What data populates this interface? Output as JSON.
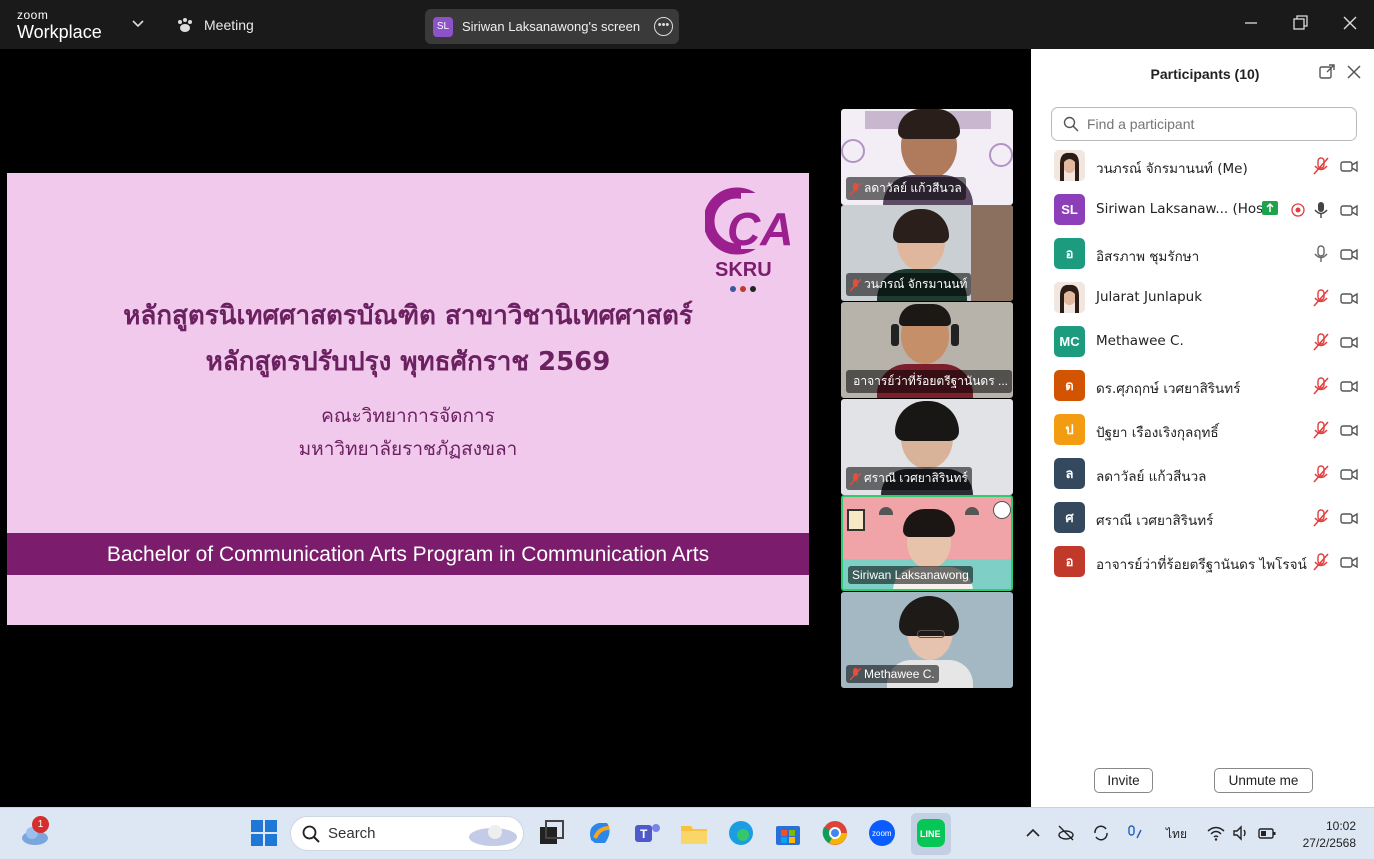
{
  "app": {
    "brand_top": "zoom",
    "brand_bottom": "Workplace",
    "meeting_label": "Meeting"
  },
  "share": {
    "avatar": "SL",
    "label": "Siriwan Laksanawong's screen"
  },
  "slide": {
    "line1": "หลักสูตรนิเทศศาสตรบัณฑิต สาขาวิชานิเทศศาสตร์",
    "line2": "หลักสูตรปรับปรุง พุทธศักราช 2569",
    "line3": "คณะวิทยาการจัดการ",
    "line4": "มหาวิทยาลัยราชภัฏสงขลา",
    "band": "Bachelor of Communication Arts Program in Communication Arts",
    "logo_text": "CA",
    "logo_sub": "SKRU"
  },
  "video_tiles": [
    {
      "name": "ลดาวัลย์ แก้วสีนวล",
      "muted": true
    },
    {
      "name": "วนภรณ์ จักรมานนท์",
      "muted": true
    },
    {
      "name": "อาจารย์ว่าที่ร้อยตรีฐานันดร ...",
      "muted": true
    },
    {
      "name": "ศราณี เวศยาสิรินทร์",
      "muted": true
    },
    {
      "name": "Siriwan Laksanawong",
      "muted": false
    },
    {
      "name": "Methawee C.",
      "muted": true
    }
  ],
  "participants": {
    "title": "Participants (10)",
    "search_placeholder": "Find a participant",
    "list": [
      {
        "avatar": "",
        "color": "#e7d6cf",
        "name": "วนภรณ์ จักรมานนท์ (Me)",
        "mic": "muted",
        "photo": true
      },
      {
        "avatar": "SL",
        "color": "#8c3fb8",
        "name": "Siriwan Laksanaw...  (Host)",
        "mic": "on",
        "host": true
      },
      {
        "avatar": "อ",
        "color": "#1c9b7f",
        "name": "อิสรภาพ ชุมรักษา",
        "mic": "on-grey"
      },
      {
        "avatar": "",
        "color": "#e7d6cf",
        "name": "Jularat Junlapuk",
        "mic": "muted",
        "photo": true
      },
      {
        "avatar": "MC",
        "color": "#1c9b7f",
        "name": "Methawee C.",
        "mic": "muted"
      },
      {
        "avatar": "ด",
        "color": "#d35400",
        "name": "ดร.ศุภฤกษ์ เวศยาสิรินทร์",
        "mic": "muted"
      },
      {
        "avatar": "ป",
        "color": "#f39c12",
        "name": "ปัฐยา เรืองเริงกุลฤทธิ์",
        "mic": "muted"
      },
      {
        "avatar": "ล",
        "color": "#34495e",
        "name": "ลดาวัลย์ แก้วสีนวล",
        "mic": "muted"
      },
      {
        "avatar": "ศ",
        "color": "#34495e",
        "name": "ศราณี เวศยาสิรินทร์",
        "mic": "muted"
      },
      {
        "avatar": "อ",
        "color": "#c0392b",
        "name": "อาจารย์ว่าที่ร้อยตรีฐานันดร ไพโรจน์",
        "mic": "muted"
      }
    ],
    "invite_label": "Invite",
    "unmute_label": "Unmute me"
  },
  "taskbar": {
    "search_label": "Search",
    "weather_badge": "1",
    "lang": "ไทย",
    "time": "10:02",
    "date": "27/2/2568"
  }
}
